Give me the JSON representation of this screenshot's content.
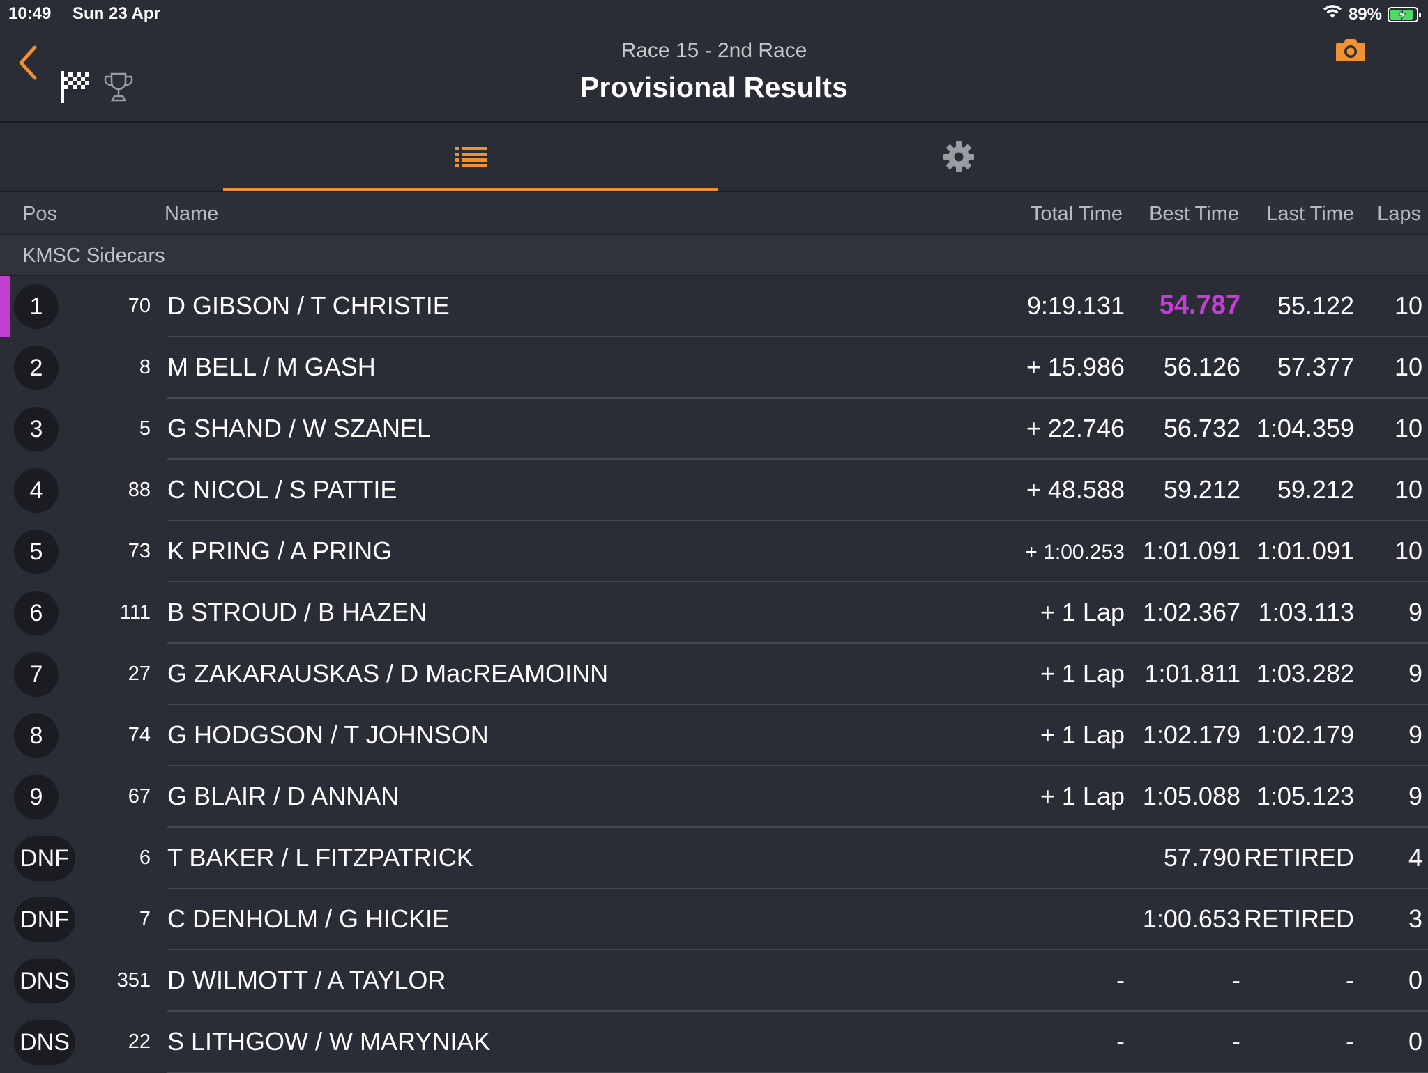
{
  "status_bar": {
    "time": "10:49",
    "date": "Sun 23 Apr",
    "battery": "89%",
    "battery_level": 0.89
  },
  "header": {
    "subtitle": "Race 15 - 2nd Race",
    "title": "Provisional Results"
  },
  "columns": {
    "pos": "Pos",
    "name": "Name",
    "total": "Total Time",
    "best": "Best Time",
    "last": "Last Time",
    "laps": "Laps"
  },
  "group": "KMSC Sidecars",
  "colors": {
    "accent": "#f0922f",
    "fastest": "#c63ed6",
    "background": "#2a2d35"
  },
  "rows": [
    {
      "pos": "1",
      "num": "70",
      "name": "D GIBSON / T CHRISTIE",
      "total": "9:19.131",
      "best": "54.787",
      "last": "55.122",
      "laps": "10"
    },
    {
      "pos": "2",
      "num": "8",
      "name": "M BELL / M GASH",
      "total": "+ 15.986",
      "best": "56.126",
      "last": "57.377",
      "laps": "10"
    },
    {
      "pos": "3",
      "num": "5",
      "name": "G SHAND / W SZANEL",
      "total": "+ 22.746",
      "best": "56.732",
      "last": "1:04.359",
      "laps": "10"
    },
    {
      "pos": "4",
      "num": "88",
      "name": "C NICOL / S PATTIE",
      "total": "+ 48.588",
      "best": "59.212",
      "last": "59.212",
      "laps": "10"
    },
    {
      "pos": "5",
      "num": "73",
      "name": "K PRING / A PRING",
      "total": "+ 1:00.253",
      "best": "1:01.091",
      "last": "1:01.091",
      "laps": "10"
    },
    {
      "pos": "6",
      "num": "111",
      "name": "B STROUD / B HAZEN",
      "total": "+ 1 Lap",
      "best": "1:02.367",
      "last": "1:03.113",
      "laps": "9"
    },
    {
      "pos": "7",
      "num": "27",
      "name": "G ZAKARAUSKAS / D MacREAMOINN",
      "total": "+ 1 Lap",
      "best": "1:01.811",
      "last": "1:03.282",
      "laps": "9"
    },
    {
      "pos": "8",
      "num": "74",
      "name": "G HODGSON / T JOHNSON",
      "total": "+ 1 Lap",
      "best": "1:02.179",
      "last": "1:02.179",
      "laps": "9"
    },
    {
      "pos": "9",
      "num": "67",
      "name": "G BLAIR / D ANNAN",
      "total": "+ 1 Lap",
      "best": "1:05.088",
      "last": "1:05.123",
      "laps": "9"
    },
    {
      "pos": "DNF",
      "num": "6",
      "name": "T BAKER / L FITZPATRICK",
      "total": "",
      "best": "57.790",
      "last": "RETIRED",
      "laps": "4"
    },
    {
      "pos": "DNF",
      "num": "7",
      "name": "C DENHOLM / G HICKIE",
      "total": "",
      "best": "1:00.653",
      "last": "RETIRED",
      "laps": "3"
    },
    {
      "pos": "DNS",
      "num": "351",
      "name": "D WILMOTT / A TAYLOR",
      "total": "-",
      "best": "-",
      "last": "-",
      "laps": "0"
    },
    {
      "pos": "DNS",
      "num": "22",
      "name": "S LITHGOW / W MARYNIAK",
      "total": "-",
      "best": "-",
      "last": "-",
      "laps": "0"
    }
  ]
}
